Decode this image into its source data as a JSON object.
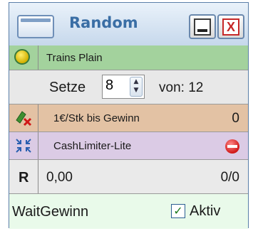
{
  "window": {
    "title": "Random",
    "minimize_symbol": "",
    "close_symbol": "X"
  },
  "rows": {
    "strategy": {
      "label": "Trains Plain",
      "icon": "yellow-dot-icon"
    },
    "bet": {
      "label": "Setze",
      "value": "8",
      "of_label": "von: 12"
    },
    "progression": {
      "label": "1€/Stk bis Gewinn",
      "value": "0",
      "icon": "chip-cross-icon"
    },
    "limiter": {
      "label": "CashLimiter-Lite",
      "icon": "compress-arrows-icon",
      "status_icon": "red-stop-icon"
    },
    "result": {
      "badge": "R",
      "amount": "0,00",
      "ratio": "0/0"
    },
    "wait": {
      "label": "WaitGewinn",
      "checkbox_label": "Aktiv",
      "checked": true,
      "check_mark": "✓"
    }
  },
  "colors": {
    "strategy_row": "#a3d29d",
    "progression_row": "#e3c2a4",
    "limiter_row": "#dbcbe5",
    "wait_row": "#e9faea",
    "title_text": "#3a6ea5"
  }
}
